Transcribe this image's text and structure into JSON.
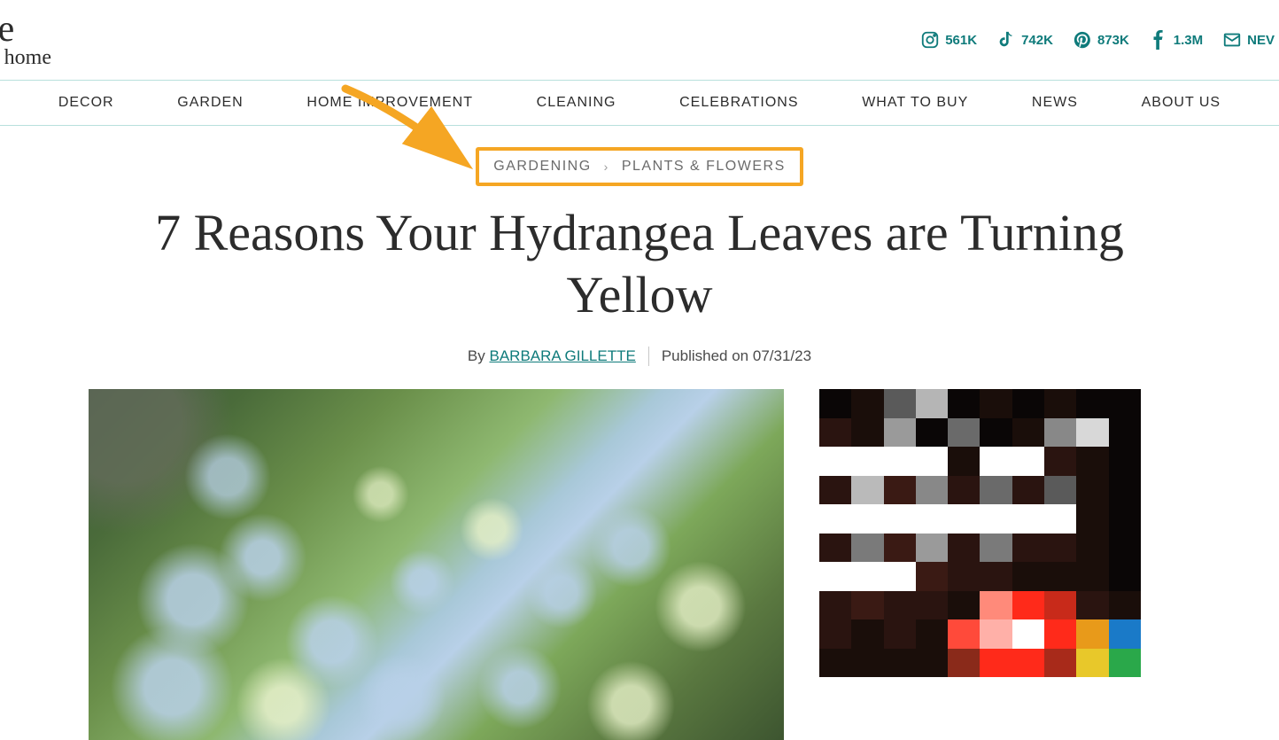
{
  "logo": {
    "main_partial": "uce",
    "tagline_partial": "best home"
  },
  "social": [
    {
      "name": "instagram",
      "count": "561K"
    },
    {
      "name": "tiktok",
      "count": "742K"
    },
    {
      "name": "pinterest",
      "count": "873K"
    },
    {
      "name": "facebook",
      "count": "1.3M"
    },
    {
      "name": "newsletter",
      "label": "NEV"
    }
  ],
  "nav": [
    "DECOR",
    "GARDEN",
    "HOME IMPROVEMENT",
    "CLEANING",
    "CELEBRATIONS",
    "WHAT TO BUY",
    "NEWS",
    "ABOUT US"
  ],
  "breadcrumb": {
    "items": [
      "GARDENING",
      "PLANTS & FLOWERS"
    ]
  },
  "article": {
    "title": "7 Reasons Your Hydrangea Leaves are Turning Yellow",
    "by_label": "By",
    "author": "BARBARA GILLETTE",
    "published_label": "Published on",
    "published_date": "07/31/23"
  },
  "colors": {
    "teal": "#0f7b7b",
    "annotation": "#f5a623",
    "border": "#b8e0dd"
  }
}
